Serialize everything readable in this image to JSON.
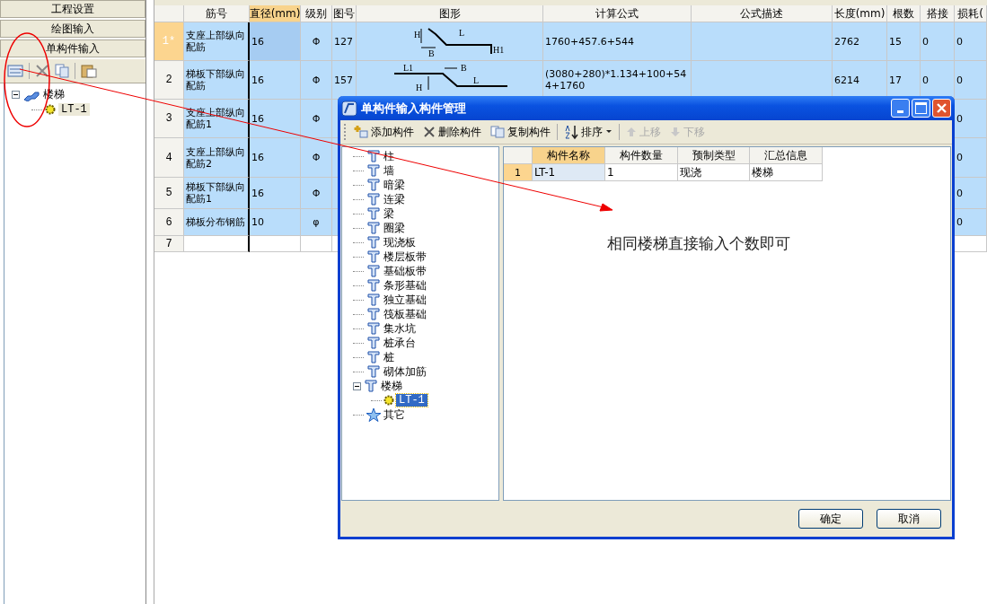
{
  "left_panel": {
    "sections": [
      {
        "label": "工程设置"
      },
      {
        "label": "绘图输入"
      },
      {
        "label": "单构件输入"
      }
    ],
    "toolbar": [
      {
        "kind": "new"
      },
      {
        "kind": "delete"
      },
      {
        "kind": "copy"
      },
      {
        "kind": "paste"
      }
    ],
    "tree": [
      {
        "label": "楼梯",
        "expanded": true,
        "children": [
          {
            "label": "LT-1",
            "selected": true
          }
        ]
      }
    ]
  },
  "table": {
    "columns": [
      {
        "label": "筋号",
        "selected": false
      },
      {
        "label": "直径(mm)",
        "selected": true
      },
      {
        "label": "级别",
        "selected": false
      },
      {
        "label": "图号",
        "selected": false
      },
      {
        "label": "图形",
        "selected": false
      },
      {
        "label": "计算公式",
        "selected": false
      },
      {
        "label": "公式描述",
        "selected": false
      },
      {
        "label": "长度(mm)",
        "selected": false
      },
      {
        "label": "根数",
        "selected": false
      },
      {
        "label": "搭接",
        "selected": false
      },
      {
        "label": "损耗(",
        "selected": false
      }
    ],
    "rows": [
      {
        "index": "1*",
        "kind": "data",
        "selected": true,
        "diameter_focused": true,
        "bar_no": "支座上部纵向配筋",
        "diameter": "16",
        "grade": "Φ",
        "figure_no": "127",
        "figure": {
          "kind": "hook",
          "labels": [
            "H",
            "B",
            "L",
            "H1"
          ]
        },
        "formula": "1760+457.6+544",
        "length": "2762",
        "count": "15",
        "lap": "0",
        "loss": "0"
      },
      {
        "index": "2",
        "kind": "data",
        "selected": false,
        "bar_no": "梯板下部纵向配筋",
        "diameter": "16",
        "grade": "Φ",
        "figure_no": "157",
        "figure": {
          "kind": "stair",
          "labels": [
            "L1",
            "B",
            "H",
            "L"
          ]
        },
        "formula": "(3080+280)*1.134+100+544+1760",
        "length": "6214",
        "count": "17",
        "lap": "0",
        "loss": "0"
      },
      {
        "index": "3",
        "kind": "data",
        "selected": false,
        "bar_no": "支座上部纵向配筋1",
        "diameter": "16",
        "grade": "Φ",
        "loss": "0"
      },
      {
        "index": "4",
        "kind": "data",
        "selected": false,
        "bar_no": "支座上部纵向配筋2",
        "diameter": "16",
        "grade": "Φ",
        "loss": "0"
      },
      {
        "index": "5",
        "kind": "data",
        "selected": false,
        "bar_no": "梯板下部纵向配筋1",
        "diameter": "16",
        "grade": "Φ",
        "loss": "0"
      },
      {
        "index": "6",
        "kind": "data",
        "selected": false,
        "bar_no": "梯板分布钢筋",
        "diameter": "10",
        "grade": "φ",
        "loss": "0"
      },
      {
        "index": "7",
        "kind": "new",
        "selected": false
      }
    ]
  },
  "dialog": {
    "title": "单构件输入构件管理",
    "toolbar": [
      {
        "label": "添加构件",
        "kind": "add",
        "disabled": false
      },
      {
        "label": "删除构件",
        "kind": "delete",
        "disabled": false
      },
      {
        "label": "复制构件",
        "kind": "copy",
        "disabled": false
      },
      {
        "label": "排序",
        "kind": "sort",
        "disabled": false,
        "dropdown": true
      },
      {
        "label": "上移",
        "kind": "up",
        "disabled": true
      },
      {
        "label": "下移",
        "kind": "down",
        "disabled": true
      }
    ],
    "tree": [
      {
        "label": "柱"
      },
      {
        "label": "墙"
      },
      {
        "label": "暗梁"
      },
      {
        "label": "连梁"
      },
      {
        "label": "梁"
      },
      {
        "label": "圈梁"
      },
      {
        "label": "现浇板"
      },
      {
        "label": "楼层板带"
      },
      {
        "label": "基础板带"
      },
      {
        "label": "条形基础"
      },
      {
        "label": "独立基础"
      },
      {
        "label": "筏板基础"
      },
      {
        "label": "集水坑"
      },
      {
        "label": "桩承台"
      },
      {
        "label": "桩"
      },
      {
        "label": "砌体加筋"
      },
      {
        "label": "楼梯",
        "expanded": true,
        "children": [
          {
            "label": "LT-1",
            "selected": true
          }
        ]
      },
      {
        "label": "其它",
        "kind": "other"
      }
    ],
    "grid": {
      "columns": [
        {
          "label": "构件名称",
          "selected": true
        },
        {
          "label": "构件数量",
          "selected": false
        },
        {
          "label": "预制类型",
          "selected": false
        },
        {
          "label": "汇总信息",
          "selected": false
        }
      ],
      "rows": [
        {
          "index": "1",
          "cells": [
            "LT-1",
            "1",
            "现浇",
            "楼梯"
          ]
        }
      ]
    },
    "note": "相同楼梯直接输入个数即可",
    "buttons": [
      "确定",
      "取消"
    ]
  }
}
